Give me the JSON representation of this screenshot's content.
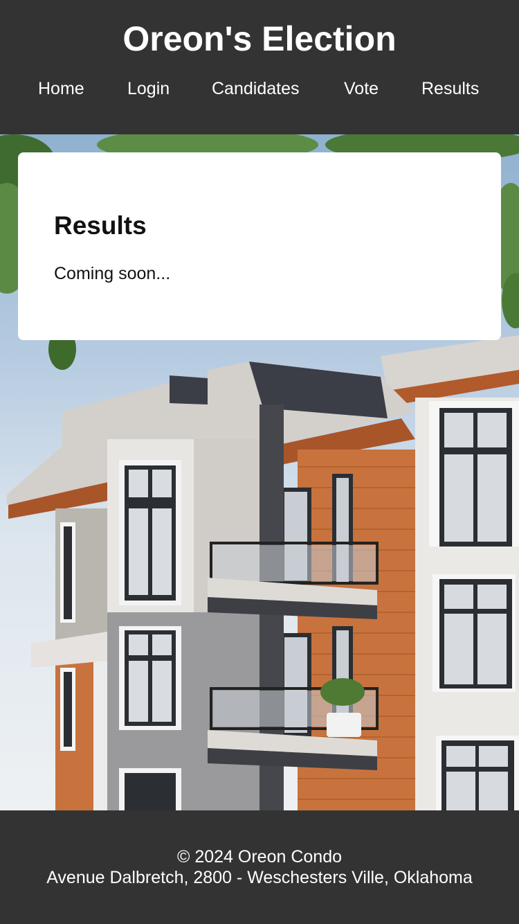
{
  "header": {
    "title": "Oreon's Election",
    "nav": [
      "Home",
      "Login",
      "Candidates",
      "Vote",
      "Results"
    ]
  },
  "main": {
    "heading": "Results",
    "message": "Coming soon..."
  },
  "footer": {
    "copyright": "© 2024 Oreon Condo",
    "address": "Avenue Dalbretch, 2800 - Weschesters Ville, Oklahoma"
  },
  "colors": {
    "header_bg": "#333333",
    "card_bg": "#ffffff",
    "siding_orange": "#c8733e",
    "siding_gray": "#bdbdbd",
    "trim_dark": "#3b3e46"
  }
}
